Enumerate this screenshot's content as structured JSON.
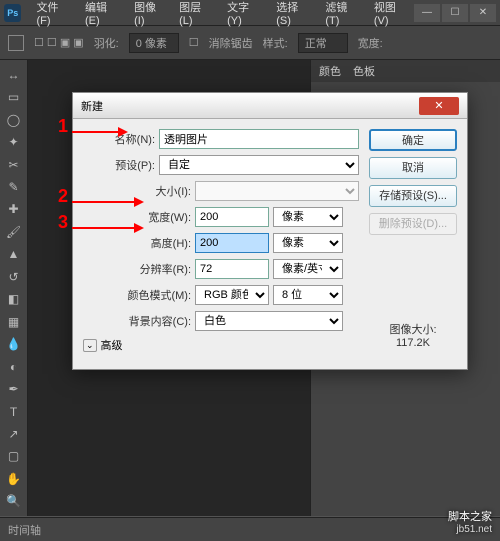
{
  "menubar": [
    "文件(F)",
    "编辑(E)",
    "图像(I)",
    "图层(L)",
    "文字(Y)",
    "选择(S)",
    "滤镜(T)",
    "视图(V)"
  ],
  "options_bar": {
    "feather_label": "羽化:",
    "feather_value": "0 像素",
    "antialias": "消除锯齿",
    "style_label": "样式:",
    "style_value": "正常",
    "width_label": "宽度:"
  },
  "panel": {
    "tab1": "颜色",
    "tab2": "色板"
  },
  "dialog": {
    "title": "新建",
    "name_label": "名称(N):",
    "name_value": "透明图片",
    "preset_label": "预设(P):",
    "preset_value": "自定",
    "size_label": "大小(I):",
    "width_label": "宽度(W):",
    "width_value": "200",
    "width_unit": "像素",
    "height_label": "高度(H):",
    "height_value": "200",
    "height_unit": "像素",
    "res_label": "分辨率(R):",
    "res_value": "72",
    "res_unit": "像素/英寸",
    "mode_label": "颜色模式(M):",
    "mode_value": "RGB 颜色",
    "mode_bits": "8 位",
    "bg_label": "背景内容(C):",
    "bg_value": "白色",
    "advanced": "高级",
    "imgsize_label": "图像大小:",
    "imgsize_value": "117.2K",
    "ok": "确定",
    "cancel": "取消",
    "save_preset": "存储预设(S)...",
    "delete_preset": "删除预设(D)..."
  },
  "annotations": {
    "n1": "1",
    "n2": "2",
    "n3": "3"
  },
  "statusbar": {
    "timeline": "时间轴"
  },
  "watermark": {
    "main": "脚本之家",
    "sub": "jb51.net"
  }
}
